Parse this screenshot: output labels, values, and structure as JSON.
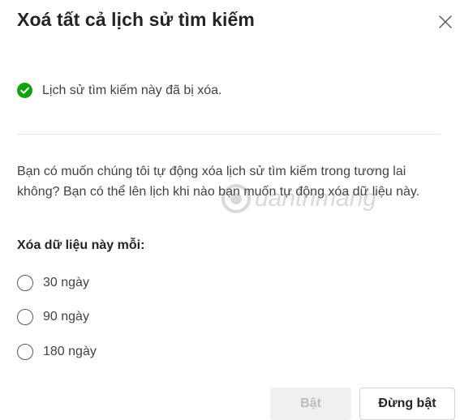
{
  "dialog": {
    "title": "Xoá tất cả lịch sử tìm kiếm",
    "close_icon": "close-icon"
  },
  "status": {
    "icon": "checkmark-circle-icon",
    "color": "#13a10e",
    "text": "Lịch sử tìm kiếm này đã bị xóa."
  },
  "description": "Bạn có muốn chúng tôi tự động xóa lịch sử tìm kiếm trong tương lai không? Bạn có thể lên lịch khi nào bạn muốn tự động xóa dữ liệu này.",
  "watermark": {
    "text": "uantrimang"
  },
  "frequency": {
    "label": "Xóa dữ liệu này mỗi:",
    "options": [
      {
        "label": "30 ngày",
        "selected": false
      },
      {
        "label": "90 ngày",
        "selected": false
      },
      {
        "label": "180 ngày",
        "selected": false
      }
    ]
  },
  "buttons": {
    "enable_label": "Bật",
    "enable_disabled": true,
    "disable_label": "Đừng bật"
  }
}
